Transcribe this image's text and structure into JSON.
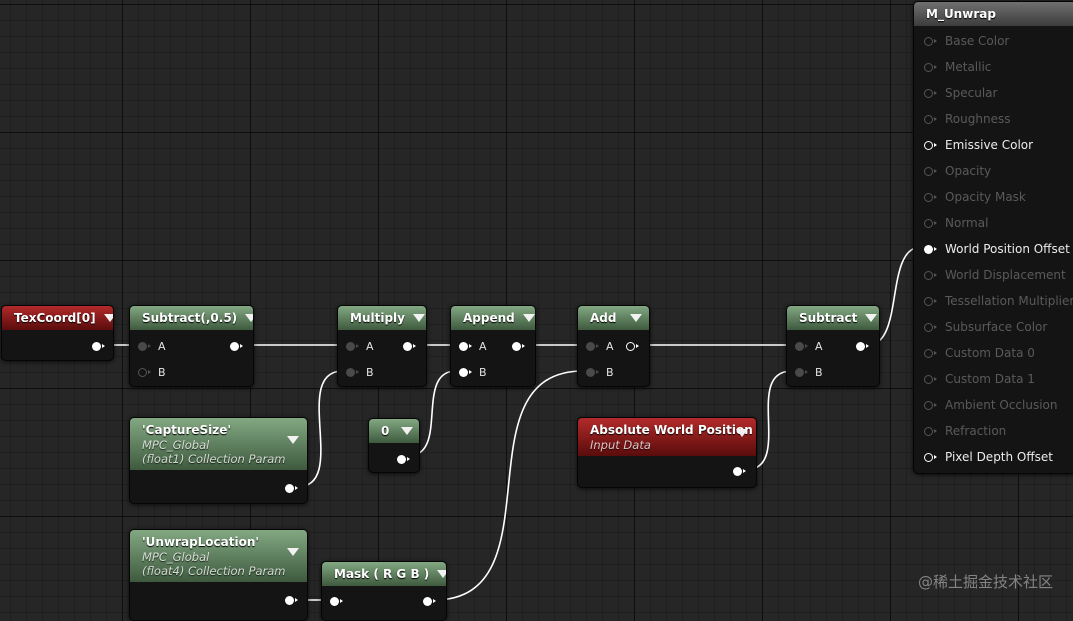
{
  "nodes": {
    "texcoord": {
      "title": "TexCoord[0]"
    },
    "subtract1": {
      "title": "Subtract(,0.5)",
      "pin_a": "A",
      "pin_b": "B"
    },
    "multiply": {
      "title": "Multiply",
      "pin_a": "A",
      "pin_b": "B"
    },
    "append": {
      "title": "Append",
      "pin_a": "A",
      "pin_b": "B"
    },
    "add": {
      "title": "Add",
      "pin_a": "A",
      "pin_b": "B"
    },
    "subtract2": {
      "title": "Subtract",
      "pin_a": "A",
      "pin_b": "B"
    },
    "capture_size": {
      "title": "'CaptureSize'",
      "line1": "MPC_Global",
      "line2": "(float1) Collection Param"
    },
    "constant_zero": {
      "title": "0"
    },
    "abs_world_pos": {
      "title": "Absolute World Position",
      "subtitle": "Input Data"
    },
    "unwrap_location": {
      "title": "'UnwrapLocation'",
      "line1": "MPC_Global",
      "line2": "(float4) Collection Param"
    },
    "mask": {
      "title": "Mask ( R G B )"
    }
  },
  "material": {
    "title": "M_Unwrap",
    "inputs": [
      {
        "label": "Base Color",
        "state": "inactive"
      },
      {
        "label": "Metallic",
        "state": "inactive"
      },
      {
        "label": "Specular",
        "state": "inactive"
      },
      {
        "label": "Roughness",
        "state": "inactive"
      },
      {
        "label": "Emissive Color",
        "state": "active"
      },
      {
        "label": "Opacity",
        "state": "inactive"
      },
      {
        "label": "Opacity Mask",
        "state": "inactive"
      },
      {
        "label": "Normal",
        "state": "inactive"
      },
      {
        "label": "World Position Offset",
        "state": "connected"
      },
      {
        "label": "World Displacement",
        "state": "inactive"
      },
      {
        "label": "Tessellation Multiplier",
        "state": "inactive"
      },
      {
        "label": "Subsurface Color",
        "state": "inactive"
      },
      {
        "label": "Custom Data 0",
        "state": "inactive"
      },
      {
        "label": "Custom Data 1",
        "state": "inactive"
      },
      {
        "label": "Ambient Occlusion",
        "state": "inactive"
      },
      {
        "label": "Refraction",
        "state": "inactive"
      },
      {
        "label": "Pixel Depth Offset",
        "state": "active"
      }
    ]
  },
  "watermark": "@稀土掘金技术社区",
  "colors": {
    "canvas": "#262626",
    "wire": "#ffffff",
    "green_header": "#6f946f",
    "red_header": "#9a1c1c",
    "node_body": "#141414"
  }
}
